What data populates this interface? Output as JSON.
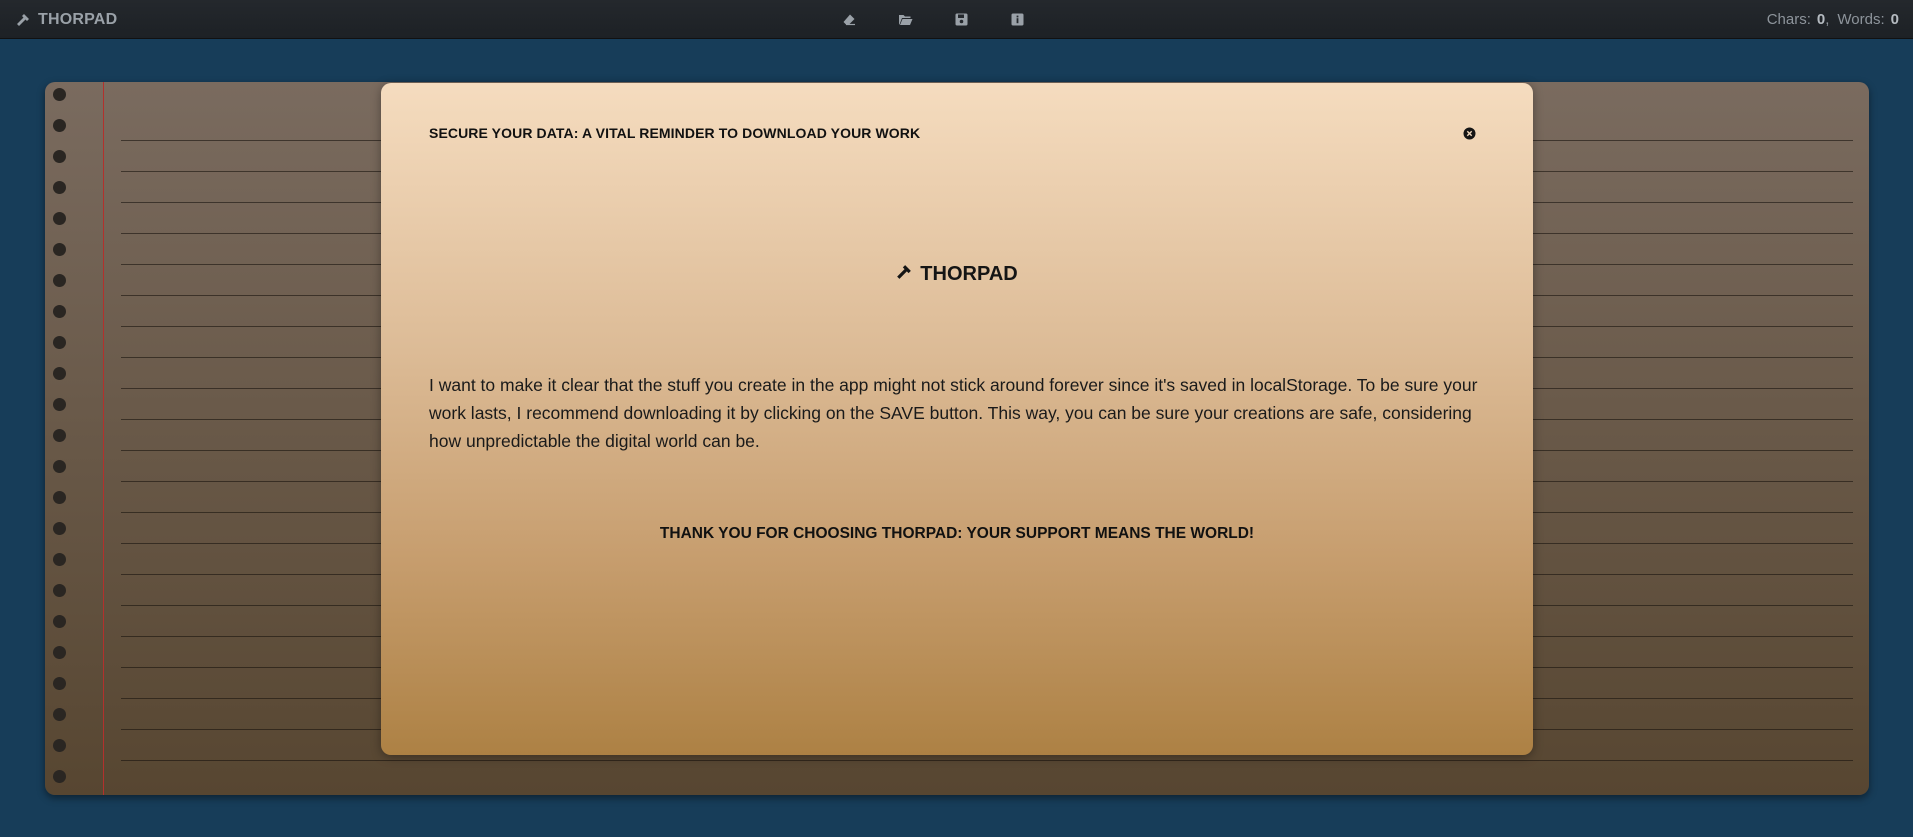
{
  "app": {
    "name": "THORPAD",
    "brand_icon": "hammer-icon"
  },
  "toolbar": {
    "tools": [
      {
        "name": "eraser-icon"
      },
      {
        "name": "folder-open-icon"
      },
      {
        "name": "save-icon"
      },
      {
        "name": "info-icon"
      }
    ]
  },
  "stats": {
    "chars_label": "Chars:",
    "chars_value": "0",
    "words_label": "Words:",
    "words_value": "0"
  },
  "modal": {
    "title": "SECURE YOUR DATA: A VITAL REMINDER TO DOWNLOAD YOUR WORK",
    "close_icon": "close-circle-icon",
    "brand": "THORPAD",
    "body": "I want to make it clear that the stuff you create in the app might not stick around forever since it's saved in localStorage. To be sure your work lasts, I recommend downloading it by clicking on the SAVE button. This way, you can be sure your creations are safe, considering how unpredictable the digital world can be.",
    "thanks": "THANK YOU FOR CHOOSING THORPAD: YOUR SUPPORT MEANS THE WORLD!"
  },
  "colors": {
    "background": "#173d59",
    "topbar": "#212529",
    "notebook_top": "#7a6b5f",
    "notebook_bottom": "#574631",
    "margin_line": "#b2312d",
    "modal_top": "#f5dcbf",
    "modal_bottom": "#ad8144"
  }
}
